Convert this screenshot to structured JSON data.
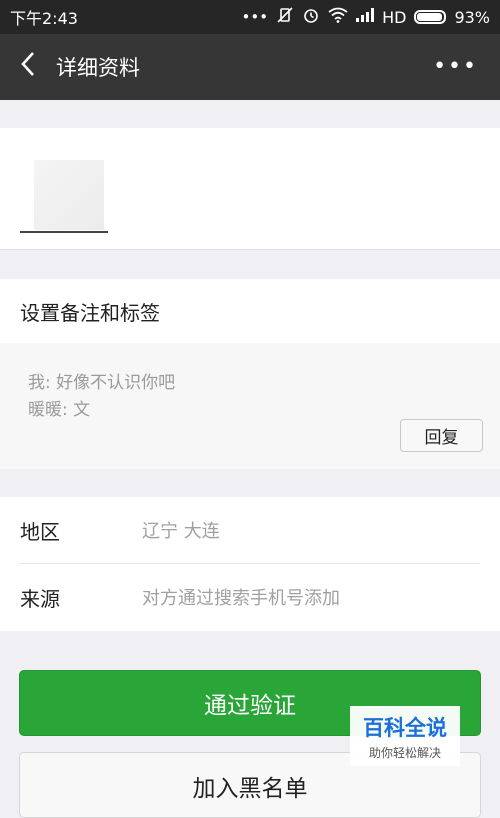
{
  "status_bar": {
    "time": "下午2:43",
    "network": "HD",
    "battery_percent": "93%",
    "battery_level": 0.93,
    "icons": [
      "more-dots-icon",
      "vibrate-off-icon",
      "alarm-icon",
      "wifi-icon",
      "signal-icon",
      "battery-icon"
    ]
  },
  "header": {
    "back_icon": "chevron-left-icon",
    "title": "详细资料",
    "more_icon": "ellipsis-icon"
  },
  "profile": {
    "avatar": "blurred-avatar"
  },
  "remark": {
    "label": "设置备注和标签"
  },
  "messages": {
    "line1": "我: 好像不认识你吧",
    "line2": "暖暖: 文",
    "reply_label": "回复"
  },
  "info": {
    "region_label": "地区",
    "region_value": "辽宁  大连",
    "source_label": "来源",
    "source_value": "对方通过搜索手机号添加"
  },
  "actions": {
    "approve_label": "通过验证",
    "blacklist_label": "加入黑名单"
  },
  "watermark": {
    "title": "百科全说",
    "subtitle": "助你轻松解决"
  },
  "colors": {
    "accent_green": "#2aa537",
    "header_bg": "#363636",
    "statusbar_bg": "#262626"
  }
}
